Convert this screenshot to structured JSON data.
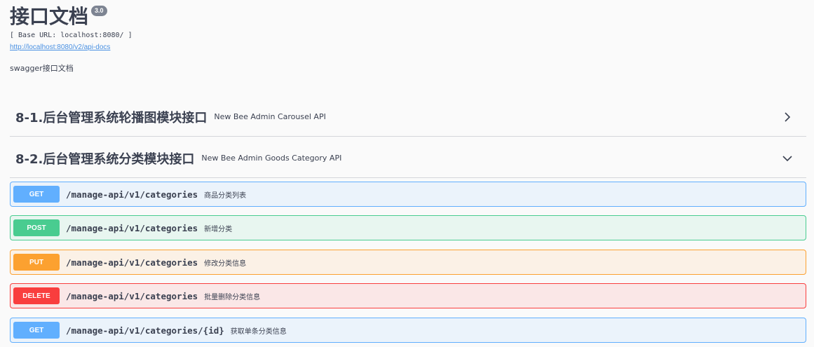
{
  "info": {
    "title": "接口文档",
    "version": "3.0",
    "base_url": "[ Base URL: localhost:8080/ ]",
    "docs_link": "http://localhost:8080/v2/api-docs",
    "description": "swagger接口文档"
  },
  "tags": [
    {
      "name": "8-1.后台管理系统轮播图模块接口",
      "description": "New Bee Admin Carousel API",
      "icon": "chevron-right-icon",
      "expanded": false
    },
    {
      "name": "8-2.后台管理系统分类模块接口",
      "description": "New Bee Admin Goods Category API",
      "icon": "chevron-down-icon",
      "expanded": true
    }
  ],
  "operations": [
    {
      "method": "GET",
      "path": "/manage-api/v1/categories",
      "summary": "商品分类列表"
    },
    {
      "method": "POST",
      "path": "/manage-api/v1/categories",
      "summary": "新增分类"
    },
    {
      "method": "PUT",
      "path": "/manage-api/v1/categories",
      "summary": "修改分类信息"
    },
    {
      "method": "DELETE",
      "path": "/manage-api/v1/categories",
      "summary": "批量删除分类信息"
    },
    {
      "method": "GET",
      "path": "/manage-api/v1/categories/{id}",
      "summary": "获取单条分类信息"
    }
  ],
  "colors": {
    "get": "#61affe",
    "post": "#49cc90",
    "put": "#fca130",
    "delete": "#f93e3e"
  }
}
